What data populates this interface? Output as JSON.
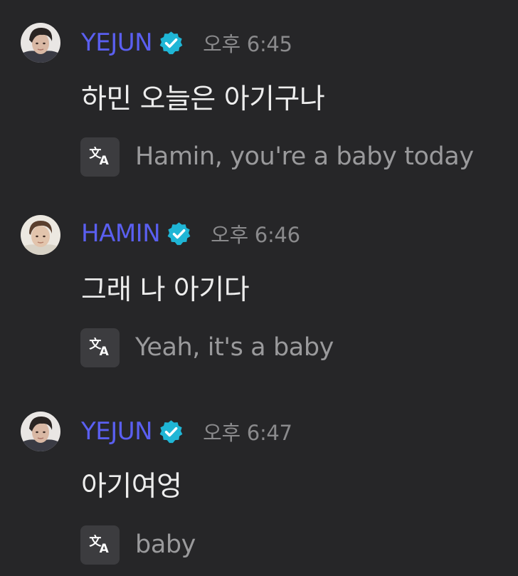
{
  "colors": {
    "background": "#262628",
    "username": "#5a5ff0",
    "badge": "#1fb6d6",
    "timestamp": "#8a8a8c",
    "message_text": "#ededed",
    "translation_text": "#9a9a9c",
    "translate_button": "#3c3c3f"
  },
  "messages": [
    {
      "author": "YEJUN",
      "verified": true,
      "time": "오후 6:45",
      "text": "하민 오늘은 아기구나",
      "translation_icon": "translate-icon",
      "translation": "Hamin, you're a baby today"
    },
    {
      "author": "HAMIN",
      "verified": true,
      "time": "오후 6:46",
      "text": "그래 나 아기다",
      "translation_icon": "translate-icon",
      "translation": "Yeah, it's a baby"
    },
    {
      "author": "YEJUN",
      "verified": true,
      "time": "오후 6:47",
      "text": "아기여엉",
      "translation_icon": "translate-icon",
      "translation": "baby"
    }
  ]
}
